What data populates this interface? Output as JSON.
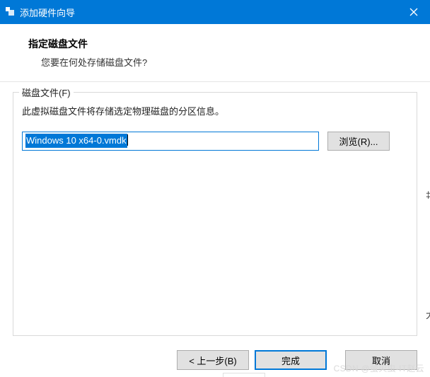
{
  "titlebar": {
    "title": "添加硬件向导"
  },
  "header": {
    "title": "指定磁盘文件",
    "subtitle": "您要在何处存储磁盘文件?"
  },
  "group": {
    "label": "磁盘文件(F)",
    "description": "此虚拟磁盘文件将存储选定物理磁盘的分区信息。",
    "file_value": "Windows 10 x64-0.vmdk",
    "browse_label": "浏览(R)..."
  },
  "footer": {
    "back_label": "< 上一步(B)",
    "finish_label": "完成",
    "cancel_label": "取消"
  },
  "watermark": "CSDN @萤火虫-IT赵云",
  "rightfrag_top": "‡",
  "rightfrag_bottom": "大"
}
